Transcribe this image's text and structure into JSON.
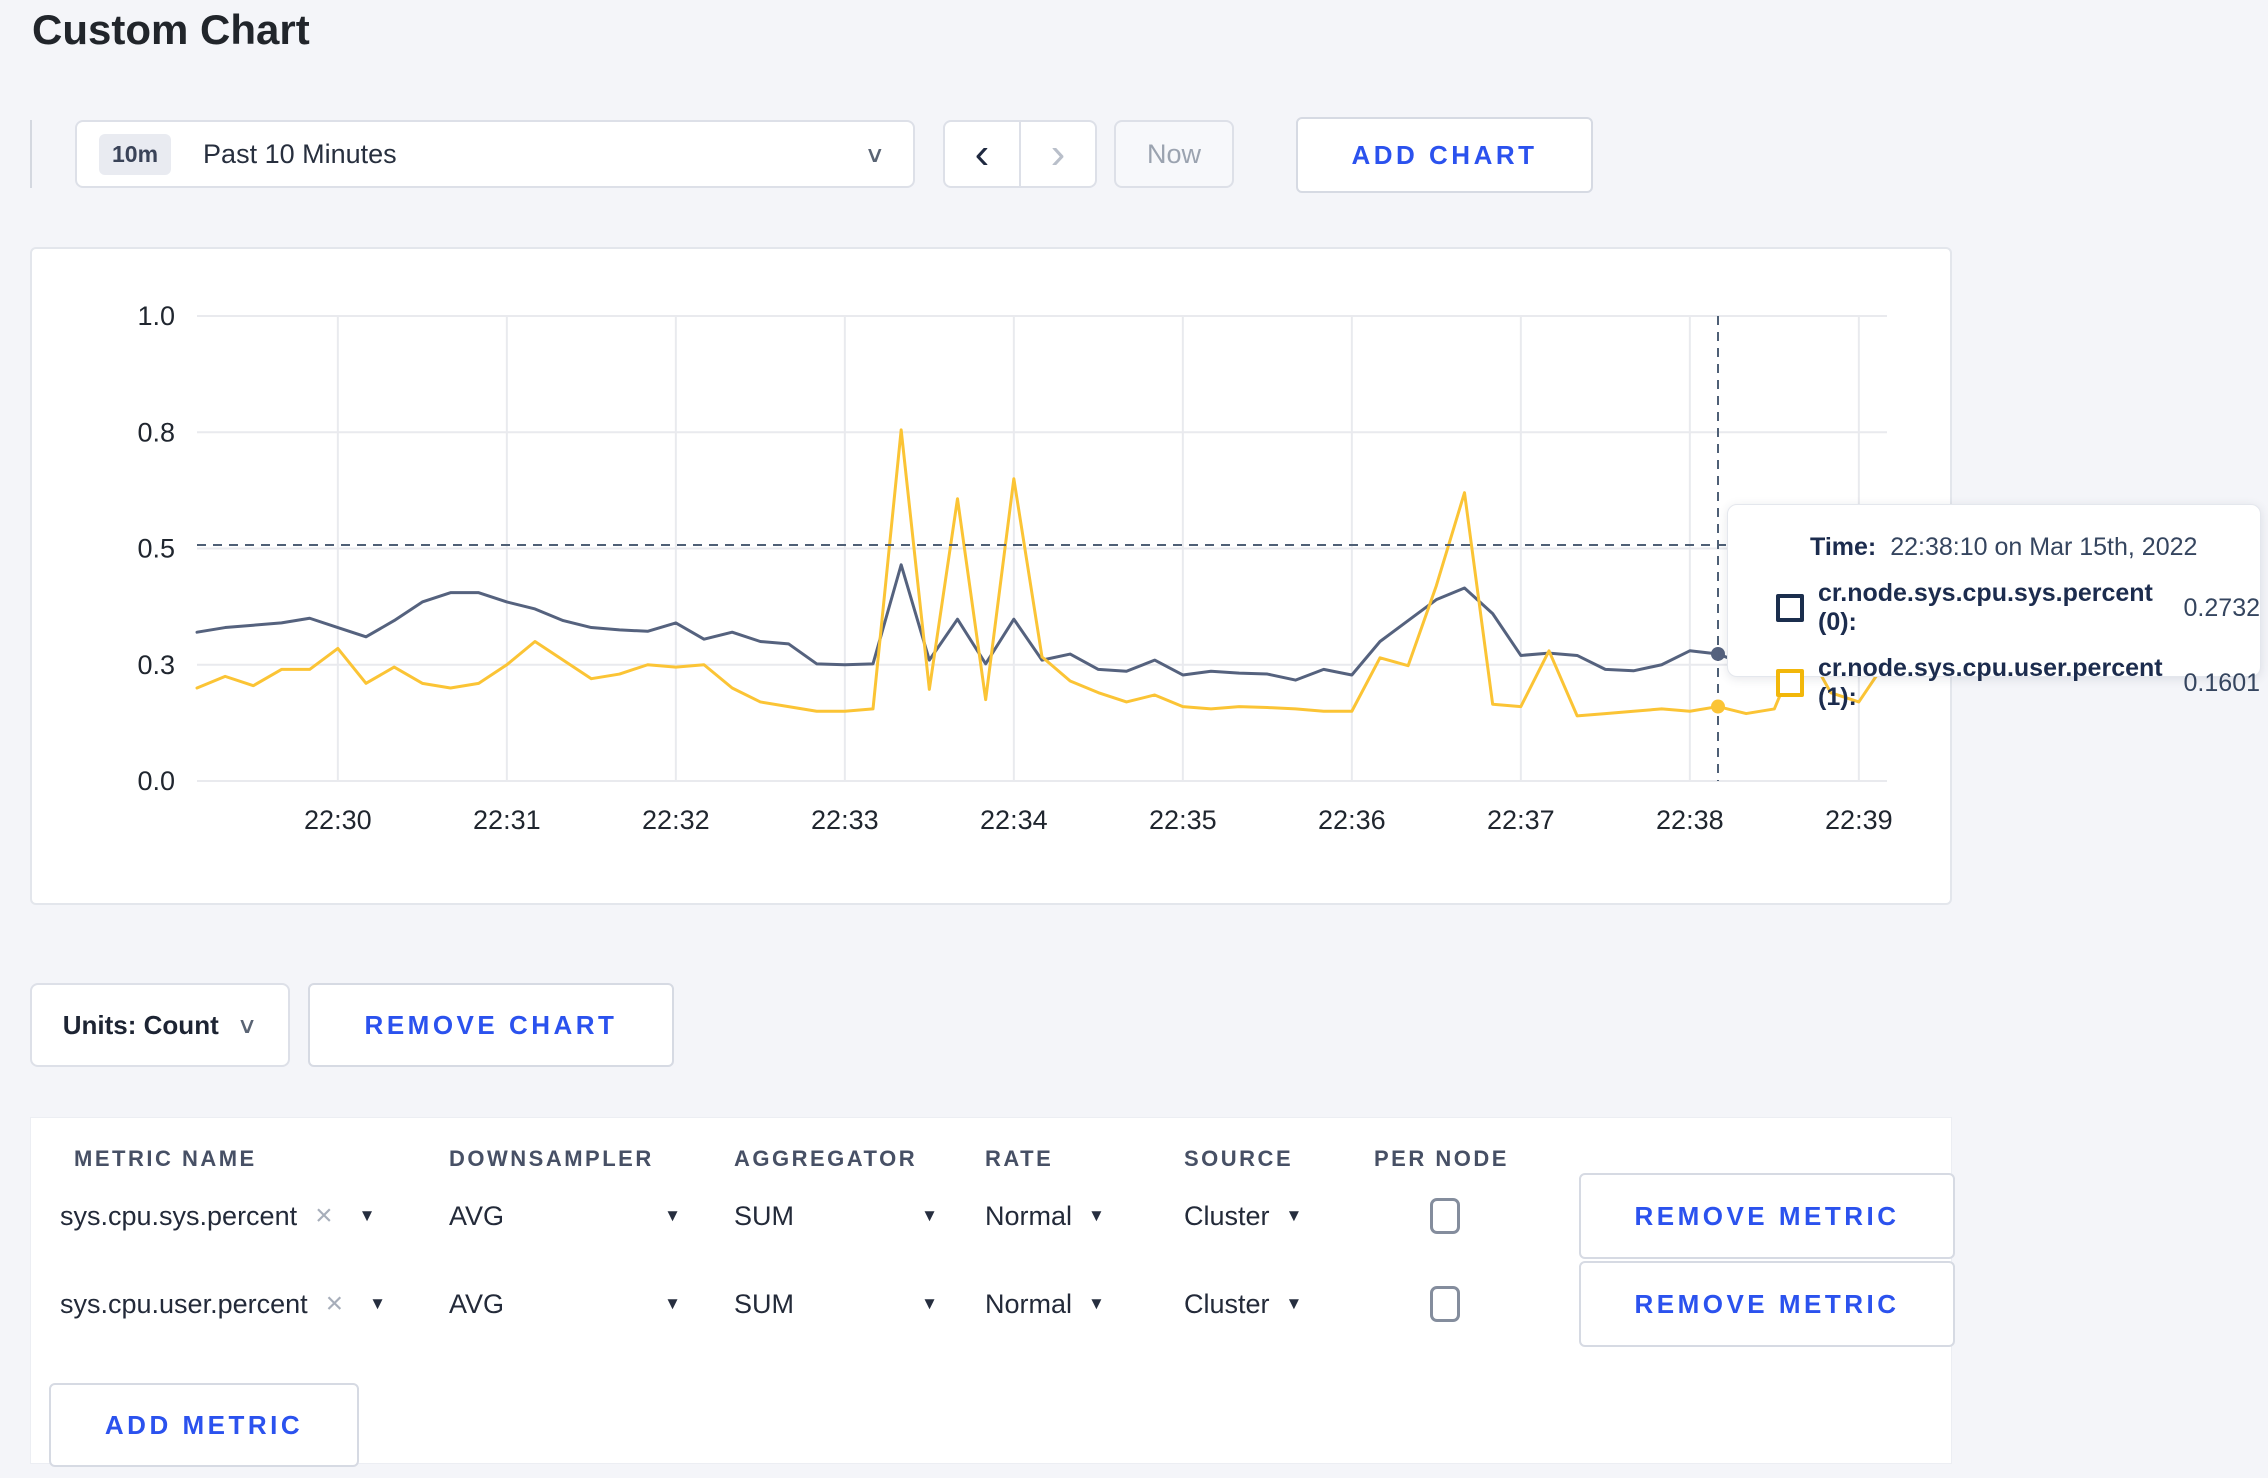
{
  "page": {
    "title": "Custom Chart"
  },
  "toolbar": {
    "range_badge": "10m",
    "range_label": "Past 10 Minutes",
    "prev_label": "‹",
    "next_label": "›",
    "now_label": "Now",
    "add_chart_label": "ADD CHART"
  },
  "chart_controls": {
    "units_label": "Units: Count",
    "remove_chart_label": "REMOVE CHART"
  },
  "colors": {
    "accent_blue": "#2b52ee",
    "series_sys": "#55627e",
    "series_user": "#fbc435",
    "swatch_sys": "#1b2e4d",
    "swatch_user": "#f2b70a",
    "grid": "#e9eaee",
    "crosshair": "#4f6076",
    "axis_text": "#20262f"
  },
  "chart_data": {
    "type": "line",
    "title": "",
    "xlabel": "",
    "ylabel": "",
    "grid": true,
    "legend_position": "tooltip",
    "x_domain_seconds": [
      0,
      600
    ],
    "x_start_time": "22:29:10",
    "x_interval_seconds": 10,
    "ylim": [
      0,
      1
    ],
    "y_ticks": [
      {
        "v": 0,
        "label": "0.0"
      },
      {
        "v": 0.25,
        "label": "0.3"
      },
      {
        "v": 0.5,
        "label": "0.5"
      },
      {
        "v": 0.75,
        "label": "0.8"
      },
      {
        "v": 1,
        "label": "1.0"
      }
    ],
    "x_ticks": [
      {
        "t": 50,
        "label": "22:30"
      },
      {
        "t": 110,
        "label": "22:31"
      },
      {
        "t": 170,
        "label": "22:32"
      },
      {
        "t": 230,
        "label": "22:33"
      },
      {
        "t": 290,
        "label": "22:34"
      },
      {
        "t": 350,
        "label": "22:35"
      },
      {
        "t": 410,
        "label": "22:36"
      },
      {
        "t": 470,
        "label": "22:37"
      },
      {
        "t": 530,
        "label": "22:38"
      },
      {
        "t": 590,
        "label": "22:39"
      }
    ],
    "series": [
      {
        "name": "cr.node.sys.cpu.sys.percent (0)",
        "color": "#55627e",
        "values": [
          0.32,
          0.33,
          0.335,
          0.34,
          0.35,
          0.33,
          0.31,
          0.345,
          0.385,
          0.405,
          0.405,
          0.385,
          0.37,
          0.345,
          0.33,
          0.325,
          0.322,
          0.34,
          0.305,
          0.32,
          0.3,
          0.295,
          0.252,
          0.25,
          0.252,
          0.465,
          0.26,
          0.348,
          0.252,
          0.348,
          0.26,
          0.273,
          0.24,
          0.236,
          0.26,
          0.228,
          0.236,
          0.232,
          0.23,
          0.217,
          0.24,
          0.228,
          0.3,
          0.345,
          0.39,
          0.415,
          0.36,
          0.27,
          0.275,
          0.27,
          0.24,
          0.237,
          0.25,
          0.28,
          0.2732,
          0.25,
          0.27,
          0.28,
          0.29,
          0.3,
          0.3
        ]
      },
      {
        "name": "cr.node.sys.cpu.user.percent (1)",
        "color": "#fbc435",
        "values": [
          0.2,
          0.225,
          0.205,
          0.24,
          0.24,
          0.285,
          0.21,
          0.245,
          0.21,
          0.2,
          0.21,
          0.25,
          0.3,
          0.26,
          0.22,
          0.23,
          0.25,
          0.245,
          0.25,
          0.2,
          0.17,
          0.16,
          0.15,
          0.15,
          0.155,
          0.755,
          0.197,
          0.607,
          0.175,
          0.65,
          0.267,
          0.215,
          0.19,
          0.17,
          0.185,
          0.16,
          0.155,
          0.16,
          0.158,
          0.155,
          0.15,
          0.15,
          0.265,
          0.248,
          0.42,
          0.62,
          0.165,
          0.16,
          0.28,
          0.14,
          0.145,
          0.15,
          0.155,
          0.15,
          0.1601,
          0.145,
          0.155,
          0.3,
          0.19,
          0.17,
          0.26
        ]
      }
    ],
    "crosshair": {
      "t": 540,
      "time_label": "22:38:10",
      "guide_value": 0.5075,
      "point_values": [
        0.2732,
        0.1601
      ]
    }
  },
  "tooltip": {
    "time_label": "Time:",
    "time_value": "22:38:10 on Mar 15th, 2022",
    "rows": [
      {
        "label": "cr.node.sys.cpu.sys.percent (0):",
        "value": "0.2732"
      },
      {
        "label": "cr.node.sys.cpu.user.percent (1):",
        "value": "0.1601"
      }
    ]
  },
  "metrics_table": {
    "headers": {
      "metric_name": "METRIC NAME",
      "downsampler": "DOWNSAMPLER",
      "aggregator": "AGGREGATOR",
      "rate": "RATE",
      "source": "SOURCE",
      "per_node": "PER NODE"
    },
    "rows": [
      {
        "name": "sys.cpu.sys.percent",
        "downsampler": "AVG",
        "aggregator": "SUM",
        "rate": "Normal",
        "source": "Cluster",
        "per_node_checked": false,
        "remove_label": "REMOVE METRIC"
      },
      {
        "name": "sys.cpu.user.percent",
        "downsampler": "AVG",
        "aggregator": "SUM",
        "rate": "Normal",
        "source": "Cluster",
        "per_node_checked": false,
        "remove_label": "REMOVE METRIC"
      }
    ],
    "add_metric_label": "ADD METRIC"
  }
}
